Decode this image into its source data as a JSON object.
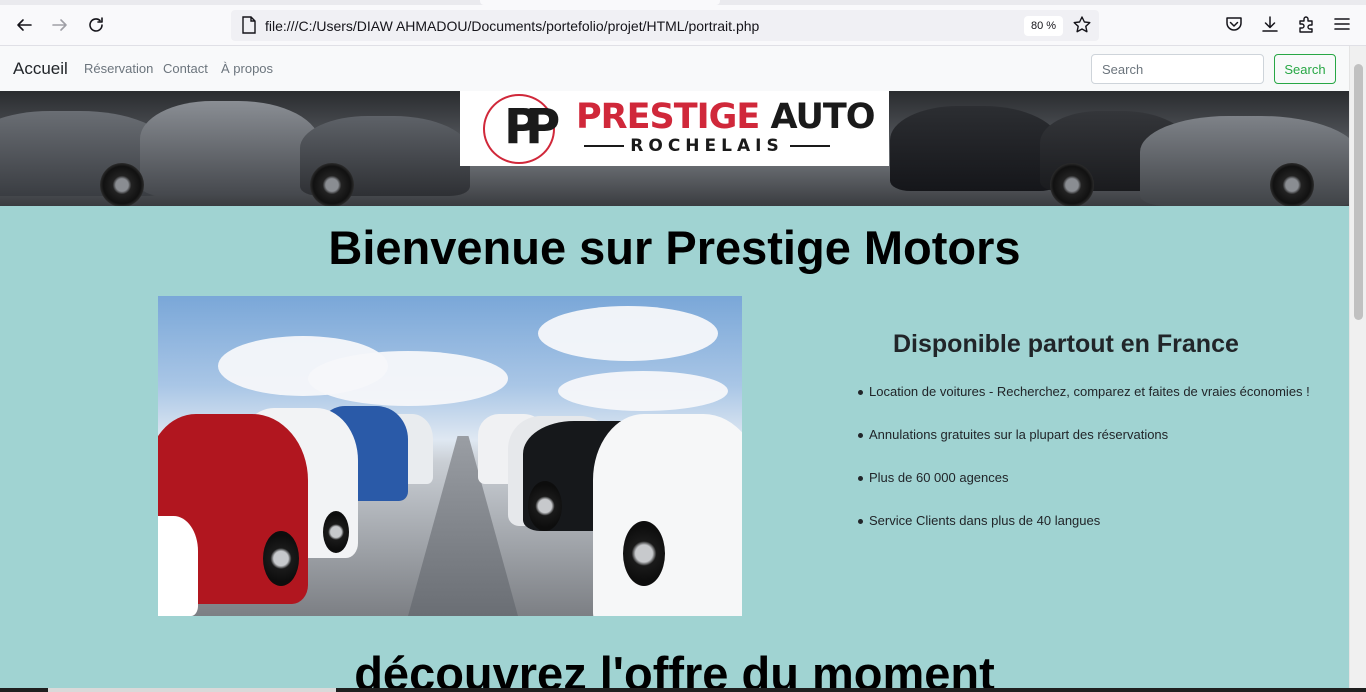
{
  "browser": {
    "url": "file:///C:/Users/DIAW AHMADOU/Documents/portefolio/projet/HTML/portrait.php",
    "zoom": "80 %",
    "icons": [
      "back-arrow-icon",
      "forward-arrow-icon",
      "reload-icon",
      "page-icon",
      "bookmark-star-icon",
      "pocket-icon",
      "download-icon",
      "extensions-icon",
      "menu-icon"
    ]
  },
  "navbar": {
    "brand": "Accueil",
    "links": [
      "Réservation",
      "Contact",
      "À propos"
    ],
    "search_placeholder": "Search",
    "search_button": "Search"
  },
  "banner": {
    "logo_initials": "PP",
    "logo_word1": "PRESTIGE",
    "logo_word2": "AUTO",
    "logo_subtitle": "ROCHELAIS"
  },
  "main": {
    "title": "Bienvenue sur Prestige Motors",
    "side_title": "Disponible partout en France",
    "features": [
      "Location de voitures - Recherchez, comparez et faites de vraies économies !",
      "Annulations gratuites sur la plupart des réservations",
      "Plus de 60 000 agences",
      "Service Clients dans plus de 40 langues"
    ],
    "offer_title": "découvrez l'offre du moment"
  },
  "colors": {
    "page_background": "#a0d3d2",
    "brand_red": "#d0283a",
    "search_green": "#28a745"
  }
}
